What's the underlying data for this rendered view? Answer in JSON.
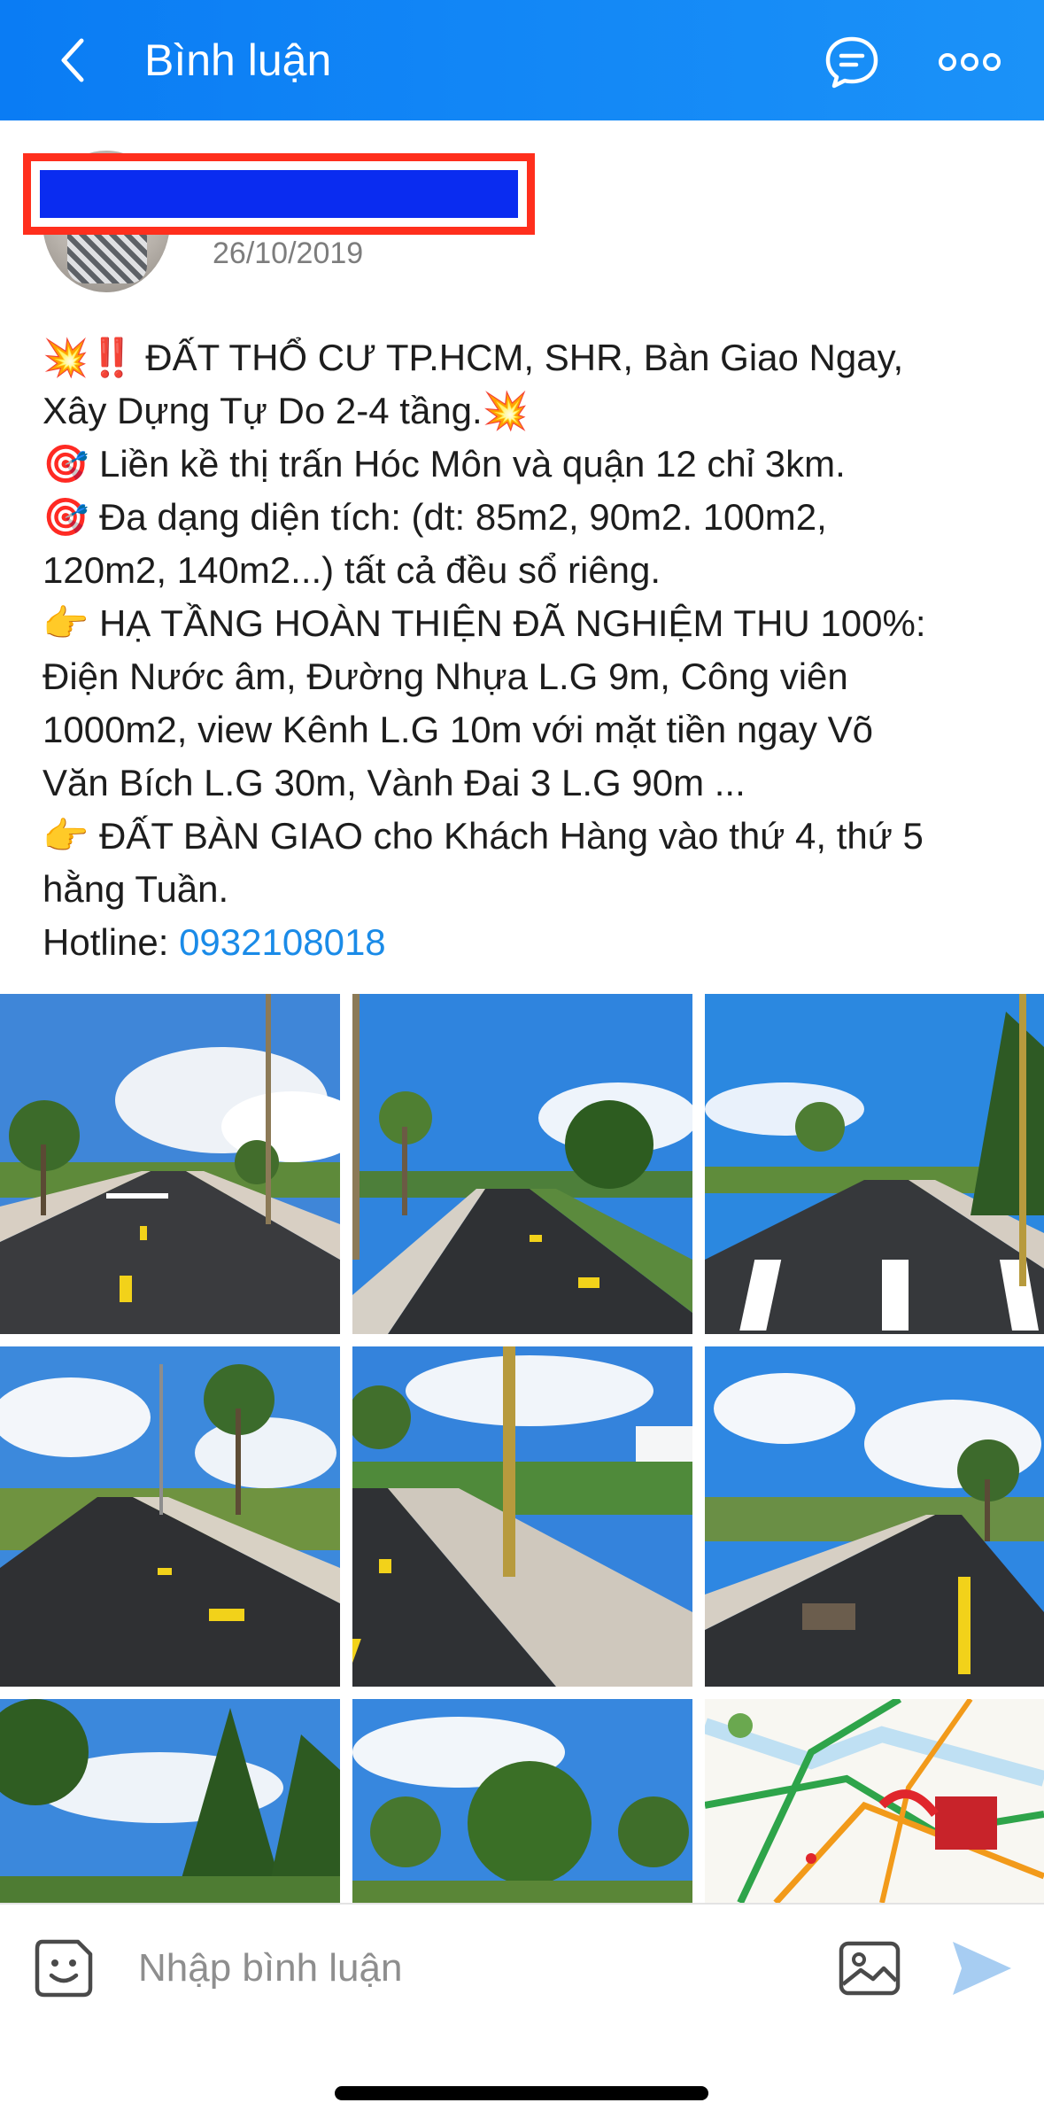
{
  "header": {
    "title": "Bình luận",
    "back_icon": "chevron-left-icon",
    "chat_icon": "chat-bubble-icon",
    "more_icon": "more-dots-icon",
    "color": "#1088f6"
  },
  "post": {
    "date": "26/10/2019",
    "lines": [
      {
        "emoji": "💥‼️",
        "text": "ĐẤT THỔ CƯ TP.HCM, SHR, Bàn Giao Ngay,"
      },
      {
        "emoji": "",
        "text": "Xây Dựng Tự Do 2-4 tầng.💥"
      },
      {
        "emoji": "🎯",
        "text": "Liền kề thị trấn Hóc Môn và quận 12 chỉ 3km."
      },
      {
        "emoji": "🎯",
        "text": "Đa dạng diện tích: (dt: 85m2, 90m2. 100m2,"
      },
      {
        "emoji": "",
        "text": "120m2, 140m2...) tất cả đều sổ riêng."
      },
      {
        "emoji": "👉",
        "text": "HẠ TẦNG HOÀN THIỆN ĐÃ NGHIỆM THU 100%:"
      },
      {
        "emoji": "",
        "text": "Điện Nước âm, Đường Nhựa L.G 9m, Công viên"
      },
      {
        "emoji": "",
        "text": "1000m2, view Kênh L.G 10m với mặt tiền ngay Võ"
      },
      {
        "emoji": "",
        "text": "Văn Bích L.G 30m, Vành Đai 3 L.G 90m ..."
      },
      {
        "emoji": "👉",
        "text": "ĐẤT BÀN GIAO cho Khách Hàng vào thứ 4, thứ 5"
      },
      {
        "emoji": "",
        "text": "hằng Tuần."
      }
    ],
    "hotline_label": "Hotline: ",
    "hotline_number": "0932108018",
    "link_color": "#1a8be8"
  },
  "photos": [
    {
      "name": "road-photo-1"
    },
    {
      "name": "road-photo-2"
    },
    {
      "name": "road-photo-3"
    },
    {
      "name": "road-photo-4"
    },
    {
      "name": "road-photo-5"
    },
    {
      "name": "road-photo-6"
    },
    {
      "name": "trees-photo-7"
    },
    {
      "name": "trees-photo-8"
    },
    {
      "name": "map-photo-9"
    }
  ],
  "composer": {
    "placeholder": "Nhập bình luận",
    "sticker_icon": "sticker-smile-icon",
    "image_icon": "image-icon",
    "send_icon": "send-icon"
  }
}
